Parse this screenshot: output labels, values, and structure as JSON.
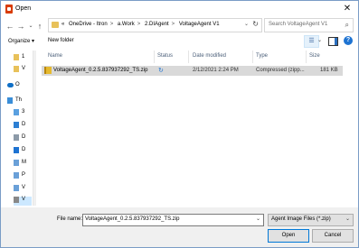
{
  "window": {
    "title": "Open"
  },
  "nav": {
    "back": "←",
    "forward": "→",
    "up_dropdown": "⌄",
    "up": "↑",
    "breadcrumb": [
      "«",
      "OneDrive - Itron",
      "a.Work",
      "2.DIAgent",
      "VoltageAgent V1"
    ],
    "breadcrumb_sep": ">",
    "refresh": "↻",
    "search_placeholder": "Search VoltageAgent V1"
  },
  "toolbar": {
    "organize": "Organize ▾",
    "new_folder": "New folder",
    "help": "?"
  },
  "sidebar": {
    "items": [
      {
        "label": "1",
        "icon": "folder-icon",
        "color": "#e8c15a"
      },
      {
        "label": "V",
        "icon": "folder-icon",
        "color": "#e8c15a"
      },
      {
        "label": "O",
        "icon": "onedrive-icon",
        "color": "#0f6fc6"
      },
      {
        "label": "Th",
        "icon": "computer-icon",
        "color": "#3a8ed8"
      },
      {
        "label": "3",
        "icon": "3d-objects-icon",
        "color": "#5aa0e0"
      },
      {
        "label": "D",
        "icon": "desktop-icon",
        "color": "#2d7fd3"
      },
      {
        "label": "D",
        "icon": "documents-icon",
        "color": "#8c9aa8"
      },
      {
        "label": "D",
        "icon": "downloads-icon",
        "color": "#1e73d2"
      },
      {
        "label": "M",
        "icon": "music-icon",
        "color": "#6aa0d8"
      },
      {
        "label": "P",
        "icon": "pictures-icon",
        "color": "#6aa0d8"
      },
      {
        "label": "V",
        "icon": "videos-icon",
        "color": "#6aa0d8"
      },
      {
        "label": "V",
        "icon": "drive-icon",
        "color": "#888888"
      }
    ]
  },
  "columns": {
    "name": "Name",
    "status": "Status",
    "date": "Date modified",
    "type": "Type",
    "size": "Size"
  },
  "files": [
    {
      "name": "VoltageAgent_0.2.5.837937292_TS.zip",
      "status": "↻",
      "date": "2/12/2021 2:24 PM",
      "type": "Compressed (zipp...",
      "size": "181 KB"
    }
  ],
  "footer": {
    "filename_label": "File name:",
    "filename_value": "VoltageAgent_0.2.5.837937292_TS.zip",
    "filetype": "Agent Image Files (*.zip)",
    "open": "Open",
    "cancel": "Cancel",
    "dropdown": "⌄"
  },
  "colors": {
    "accent": "#0078d7",
    "selection": "#d9d9d9",
    "footer_bg": "#f0f0f0"
  }
}
